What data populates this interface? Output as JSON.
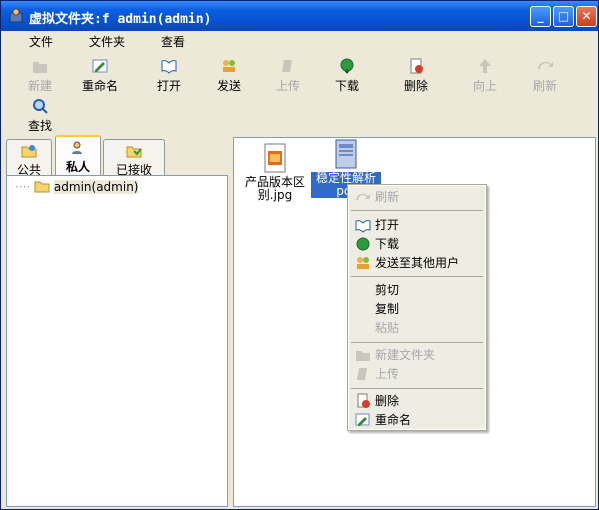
{
  "window": {
    "title": "虚拟文件夹:f admin(admin)"
  },
  "menu": [
    "文件",
    "文件夹",
    "查看"
  ],
  "toolbar": {
    "new": "新建",
    "rename": "重命名",
    "open": "打开",
    "send": "发送",
    "upload": "上传",
    "download": "下载",
    "delete": "删除",
    "up": "向上",
    "refresh": "刷新",
    "find": "查找"
  },
  "tabs": [
    "公共",
    "私人",
    "已接收"
  ],
  "tree": {
    "root": "admin(admin)"
  },
  "files": [
    {
      "name_line1": "产品版本区",
      "name_line2": "别.jpg"
    },
    {
      "name_line1": "稳定性解析",
      "name_line2": "pdf"
    }
  ],
  "context_menu": {
    "refresh": "刷新",
    "open": "打开",
    "download": "下载",
    "send_to_others": "发送至其他用户",
    "cut": "剪切",
    "copy": "复制",
    "paste": "粘贴",
    "new_folder": "新建文件夹",
    "upload": "上传",
    "delete": "删除",
    "rename": "重命名"
  },
  "colors": {
    "titlebar": "#0A5FE0",
    "selection": "#316AC5",
    "disabled": "#A7A6AA"
  }
}
